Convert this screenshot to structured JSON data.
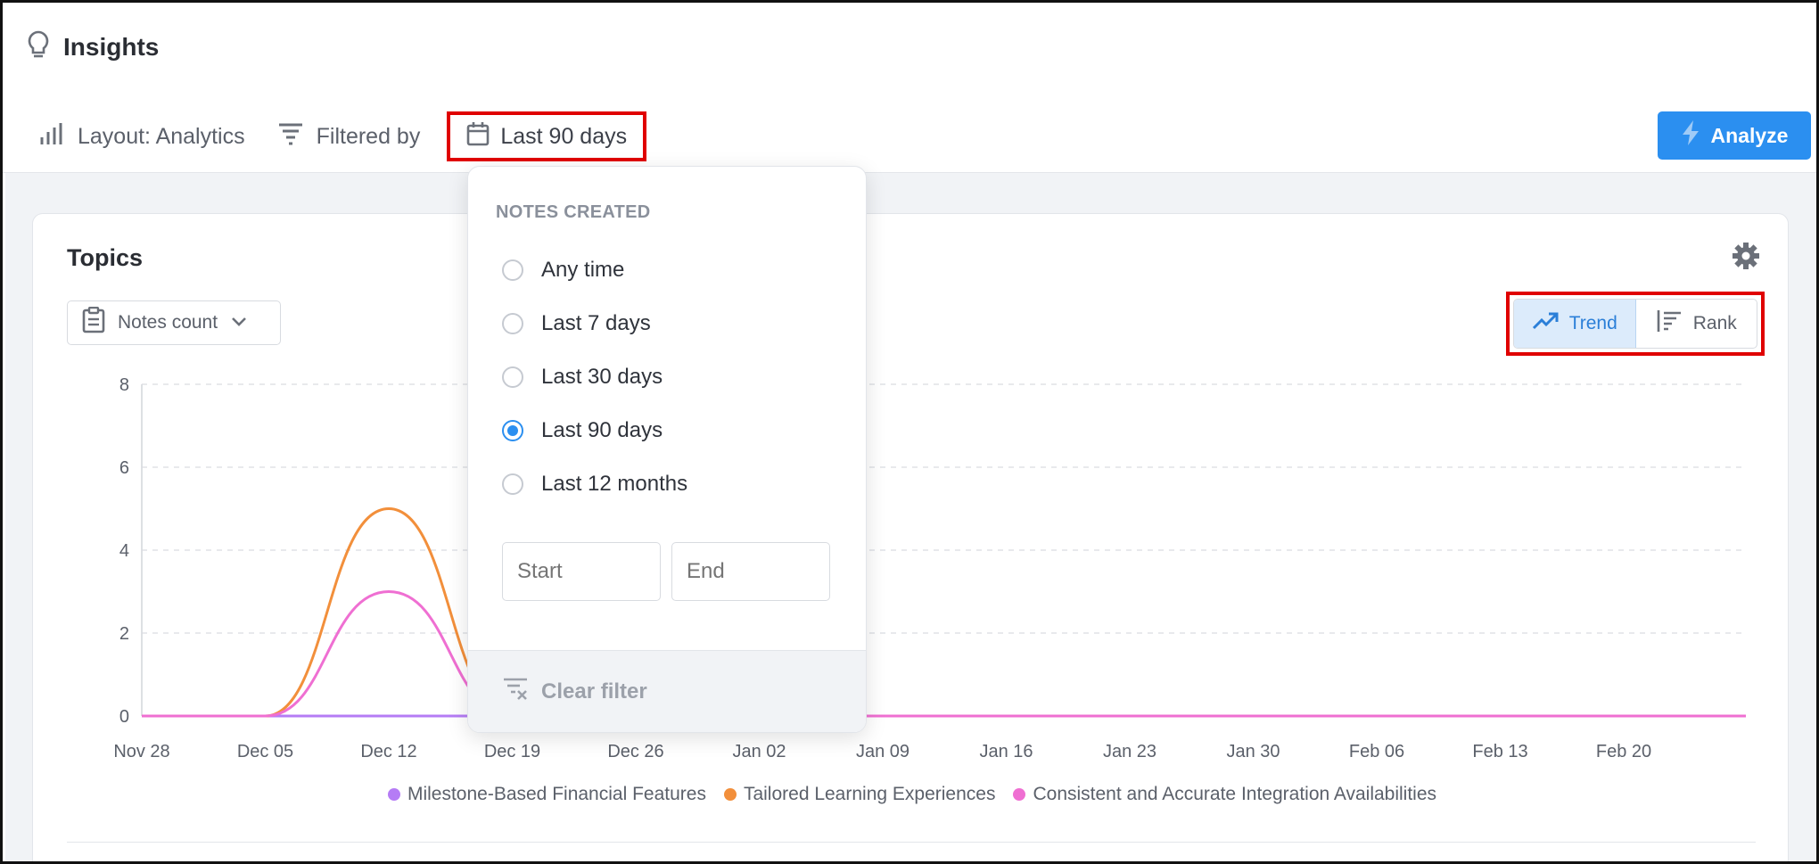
{
  "header": {
    "title": "Insights",
    "layout_label": "Layout: Analytics",
    "filter_label": "Filtered by",
    "date_filter_label": "Last 90 days",
    "analyze_label": "Analyze"
  },
  "card": {
    "title": "Topics",
    "metric_label": "Notes count",
    "view_toggle": {
      "trend": "Trend",
      "rank": "Rank",
      "selected": "Trend"
    }
  },
  "date_popup": {
    "heading": "NOTES CREATED",
    "options": [
      {
        "label": "Any time",
        "selected": false
      },
      {
        "label": "Last 7 days",
        "selected": false
      },
      {
        "label": "Last 30 days",
        "selected": false
      },
      {
        "label": "Last 90 days",
        "selected": true
      },
      {
        "label": "Last 12 months",
        "selected": false
      }
    ],
    "start_placeholder": "Start",
    "end_placeholder": "End",
    "clear_label": "Clear filter"
  },
  "colors": {
    "accent": "#2b8ff0",
    "highlight": "#e00000",
    "series_purple": "#b57cf5",
    "series_orange": "#f28f3b",
    "series_pink": "#ef6fd2"
  },
  "chart_data": {
    "type": "line",
    "x": [
      "Nov 28",
      "Dec 05",
      "Dec 12",
      "Dec 19",
      "Dec 26",
      "Jan 02",
      "Jan 09",
      "Jan 16",
      "Jan 23",
      "Jan 30",
      "Feb 06",
      "Feb 13",
      "Feb 20"
    ],
    "ylim": [
      0,
      8
    ],
    "yticks": [
      0,
      2,
      4,
      6,
      8
    ],
    "grid": true,
    "legend": "bottom",
    "series": [
      {
        "name": "Milestone-Based Financial Features",
        "color": "#b57cf5",
        "values": [
          0,
          0,
          0,
          0,
          0,
          0,
          0,
          0,
          0,
          0,
          0,
          0,
          0
        ]
      },
      {
        "name": "Tailored Learning Experiences",
        "color": "#f28f3b",
        "values": [
          0,
          0,
          5,
          0,
          0,
          0,
          0,
          0,
          0,
          0,
          0,
          0,
          0
        ]
      },
      {
        "name": "Consistent and Accurate Integration Availabilities",
        "color": "#ef6fd2",
        "values": [
          0,
          0,
          3,
          0,
          0,
          0,
          0,
          0,
          0,
          0,
          0,
          0,
          0
        ]
      }
    ]
  }
}
